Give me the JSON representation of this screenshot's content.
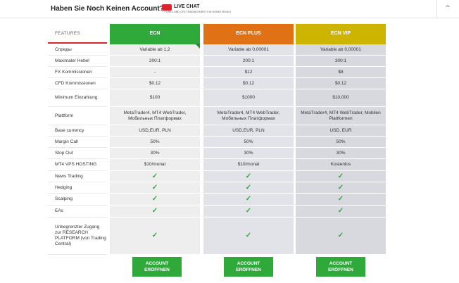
{
  "header": {
    "title": "Haben Sie Noch Keinen Account?",
    "live_chat": "LIVE CHAT",
    "live_sub": "* FOREX UND CFD TRADING BIRGT EIN HOHES RISIKO"
  },
  "table": {
    "features_label": "FEATURES",
    "columns": [
      {
        "name": "ECN",
        "color": "#2faa3a"
      },
      {
        "name": "ECN PLUS",
        "color": "#e07114"
      },
      {
        "name": "ECN VIP",
        "color": "#cdb400"
      }
    ],
    "rows": [
      {
        "label": "Спреды",
        "values": [
          "Variable ab 1,2",
          "Variable ab 0,00001",
          "Variable ab 0,00001"
        ]
      },
      {
        "label": "Maximaler Hebel",
        "values": [
          "200:1",
          "200:1",
          "300:1"
        ]
      },
      {
        "label": "FX Kommissionen",
        "values": [
          "-",
          "$12",
          "$8"
        ]
      },
      {
        "label": "CFD Kommissionen",
        "values": [
          "$0.12",
          "$0.12",
          "$0.12"
        ]
      },
      {
        "label": "Minimum Einzahlung",
        "values": [
          "$100",
          "$1000",
          "$10,000"
        ]
      },
      {
        "label": "Plattform",
        "values": [
          "MetaTrader4, MT4 WebTrader, Мобильных Платформах",
          "MetaTrader4, MT4 WebTrader, Мобильных Платформах",
          "MetaTrader4, MT4 WebTrader, Mobilen Plattformen"
        ]
      },
      {
        "label": "Base currency",
        "values": [
          "USD,EUR, PLN",
          "USD,EUR, PLN",
          "USD, EUR"
        ]
      },
      {
        "label": "Margin Call",
        "values": [
          "50%",
          "50%",
          "50%"
        ]
      },
      {
        "label": "Stop Out",
        "values": [
          "30%",
          "30%",
          "30%"
        ]
      },
      {
        "label": "MT4 VPS HOSTING",
        "values": [
          "$10/monat",
          "$10/monat",
          "Kostenlos"
        ]
      },
      {
        "label": "News Trading",
        "values": [
          "✓",
          "✓",
          "✓"
        ]
      },
      {
        "label": "Hedging",
        "values": [
          "✓",
          "✓",
          "✓"
        ]
      },
      {
        "label": "Scalping",
        "values": [
          "✓",
          "✓",
          "✓"
        ]
      },
      {
        "label": "EAs",
        "values": [
          "✓",
          "✓",
          "✓"
        ]
      },
      {
        "label": "Unbegrenzter Zugang zur RESEARCH PLATFORM (von Trading Central)",
        "values": [
          "✓",
          "✓",
          "✓"
        ]
      }
    ],
    "button_label": "ACCOUNT ERÖFFNEN"
  }
}
